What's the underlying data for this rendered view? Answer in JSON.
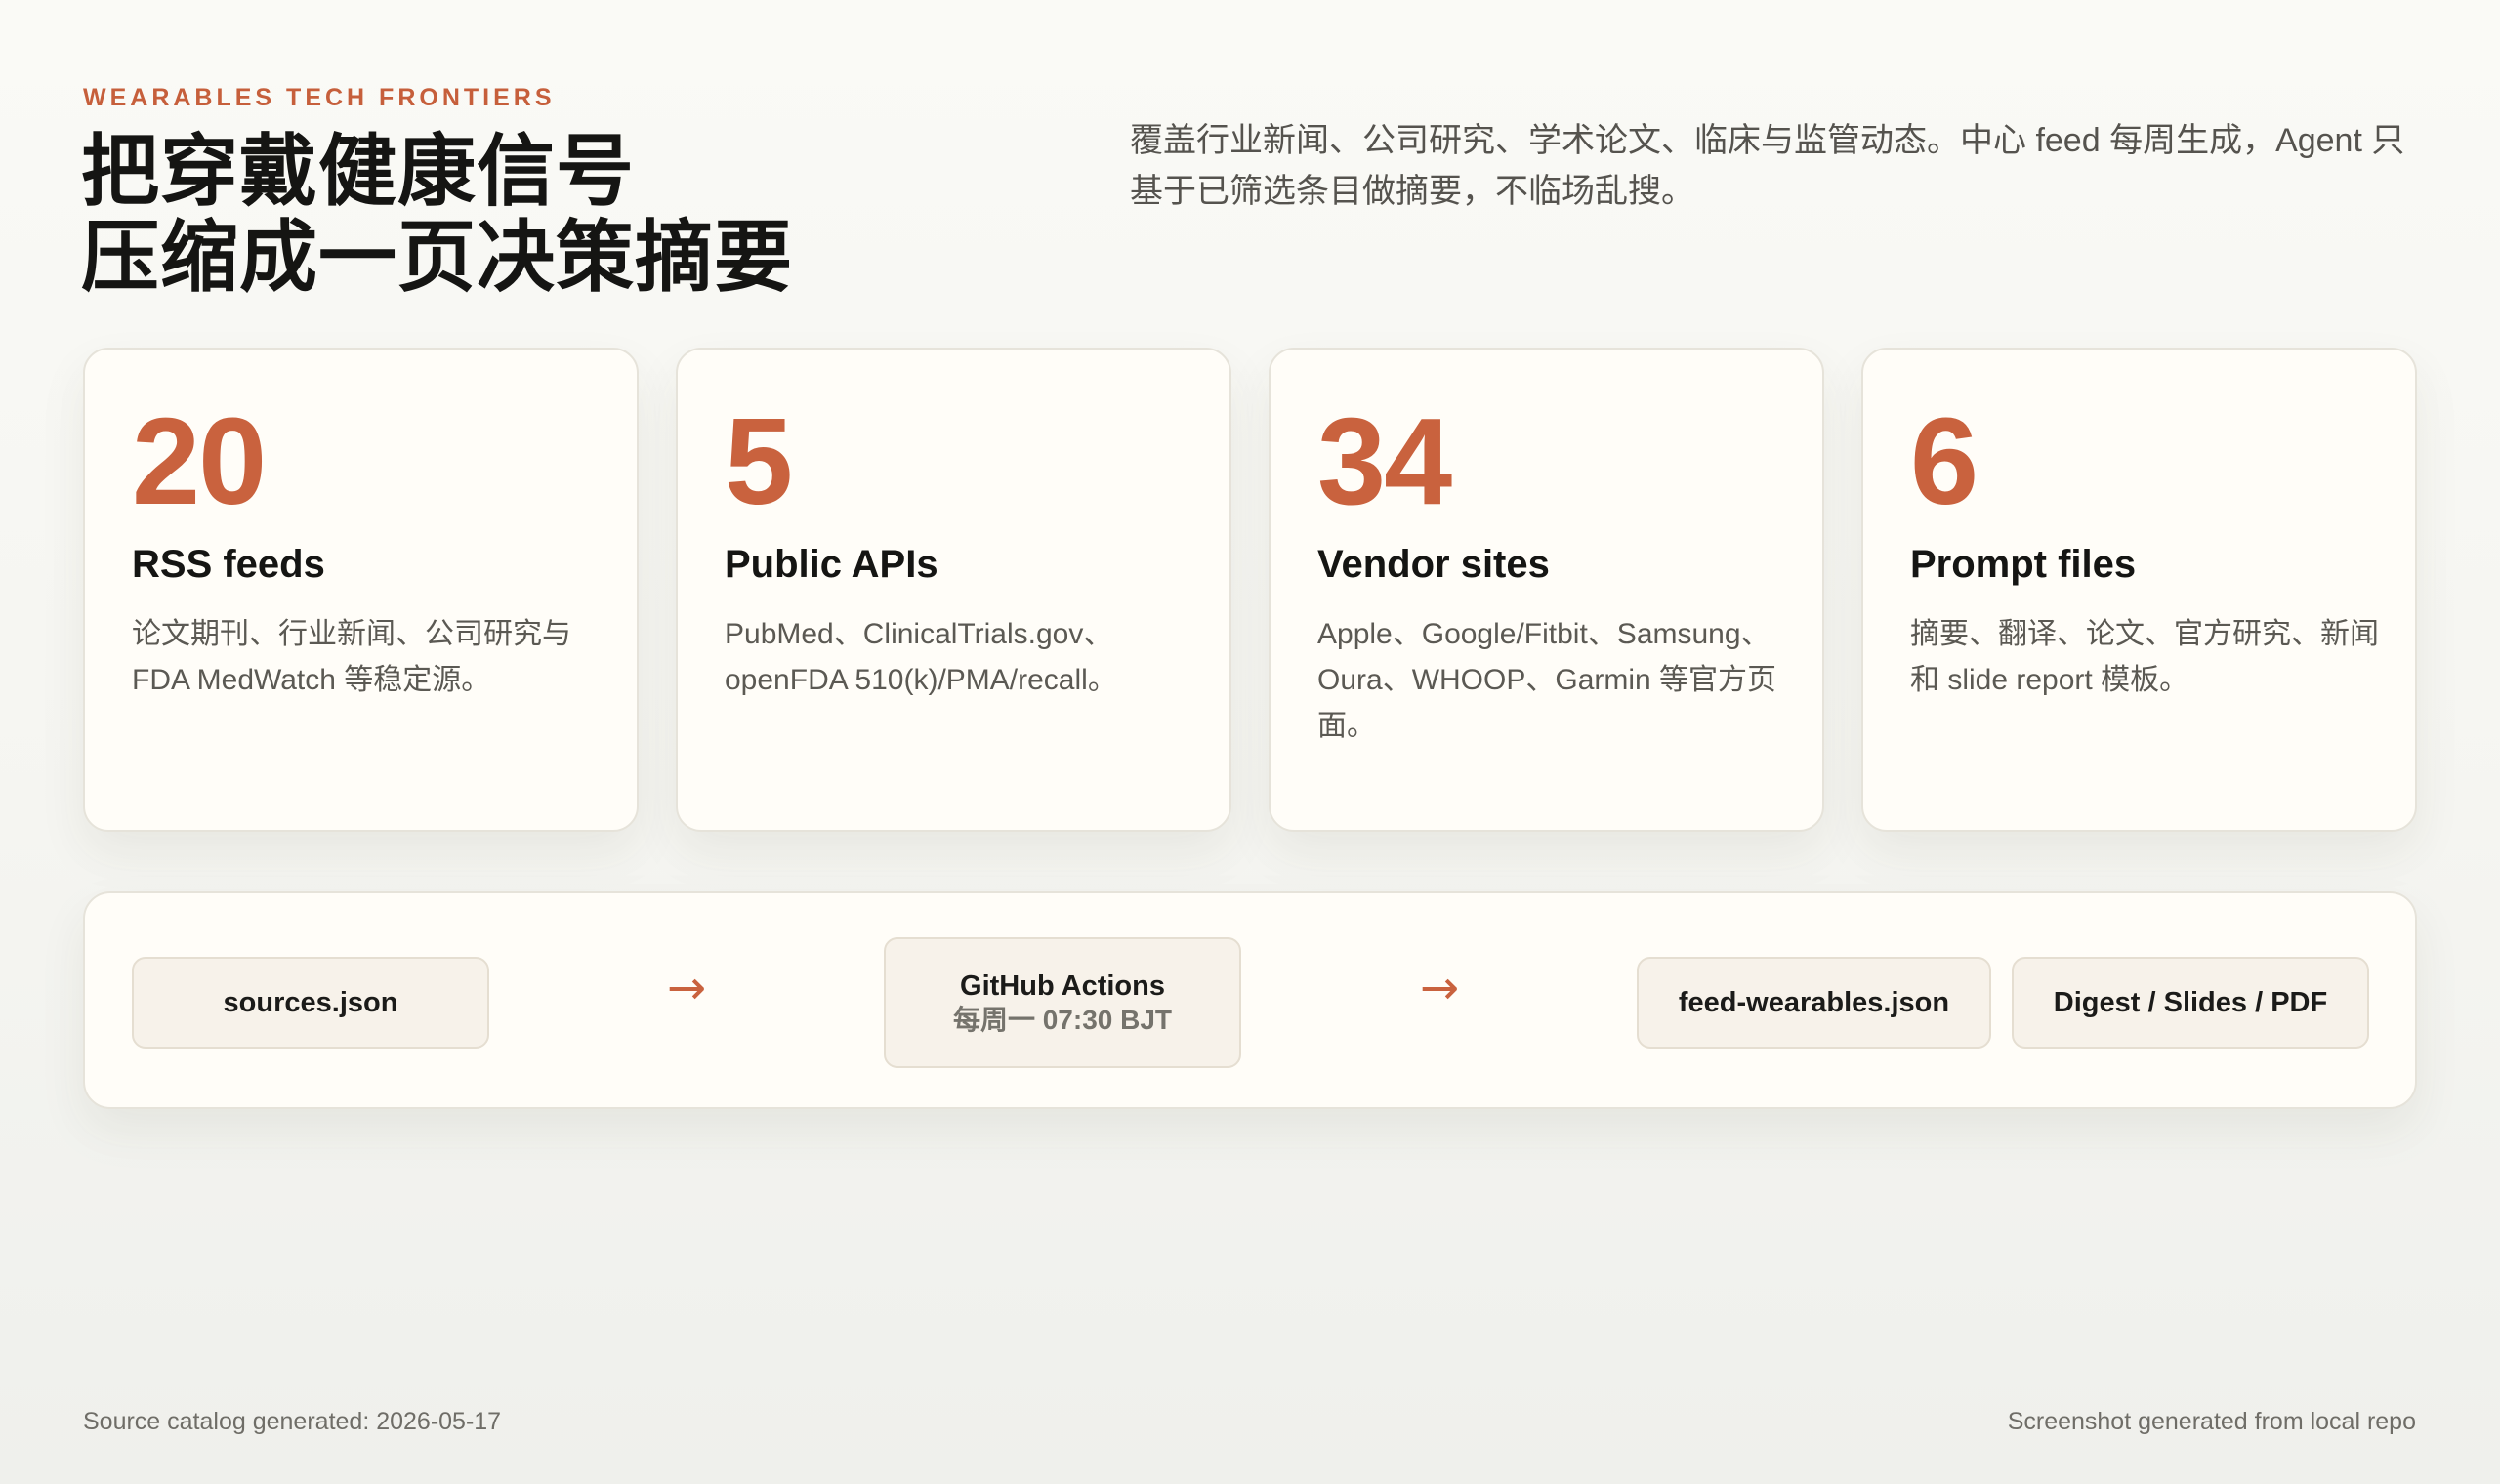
{
  "header": {
    "eyebrow": "WEARABLES TECH FRONTIERS",
    "title_line1": "把穿戴健康信号",
    "title_line2": "压缩成一页决策摘要",
    "intro": "覆盖行业新闻、公司研究、学术论文、临床与监管动态。中心 feed 每周生成，Agent 只基于已筛选条目做摘要，不临场乱搜。"
  },
  "stats": [
    {
      "value": "20",
      "label": "RSS feeds",
      "desc": "论文期刊、行业新闻、公司研究与 FDA MedWatch 等稳定源。"
    },
    {
      "value": "5",
      "label": "Public APIs",
      "desc": "PubMed、ClinicalTrials.gov、openFDA 510(k)/PMA/recall。"
    },
    {
      "value": "34",
      "label": "Vendor sites",
      "desc": "Apple、Google/Fitbit、Samsung、Oura、WHOOP、Garmin 等官方页面。"
    },
    {
      "value": "6",
      "label": "Prompt files",
      "desc": "摘要、翻译、论文、官方研究、新闻和 slide report 模板。"
    }
  ],
  "pipeline": {
    "step1": "sources.json",
    "step2_title": "GitHub Actions",
    "step2_sub": "每周一 07:30 BJT",
    "step3": "feed-wearables.json",
    "step4": "Digest / Slides / PDF",
    "arrow_glyph": "→"
  },
  "footer": {
    "left": "Source catalog generated: 2026-05-17",
    "right": "Screenshot generated from local repo"
  },
  "colors": {
    "accent": "#c9623e",
    "background": "#f7f7f3",
    "card": "#fffdf8",
    "chip": "#f7f2ea"
  },
  "icons": {
    "flow_arrow": "arrow-right-icon"
  }
}
